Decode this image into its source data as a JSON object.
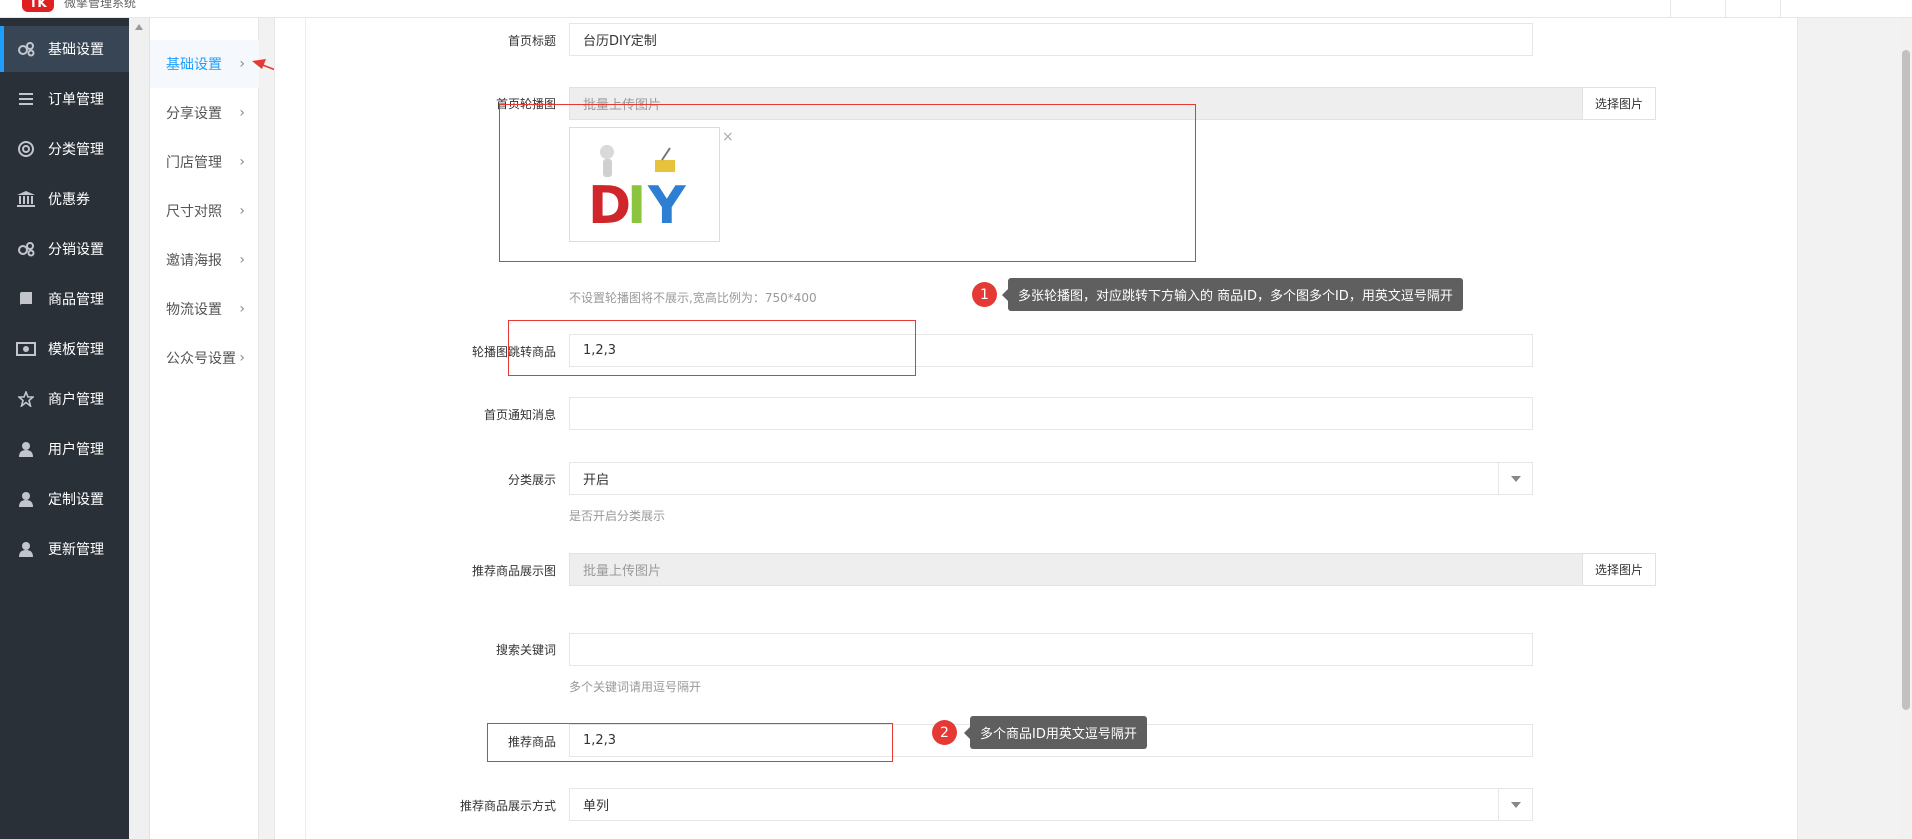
{
  "topbar": {
    "logo_text": "TK",
    "brand": "微擎管理系统"
  },
  "sidebar": {
    "items": [
      {
        "label": "基础设置",
        "icon": "cogs-icon",
        "active": true
      },
      {
        "label": "订单管理",
        "icon": "list-icon"
      },
      {
        "label": "分类管理",
        "icon": "support-icon"
      },
      {
        "label": "优惠券",
        "icon": "bank-icon"
      },
      {
        "label": "分销设置",
        "icon": "cogs-icon"
      },
      {
        "label": "商品管理",
        "icon": "book-icon"
      },
      {
        "label": "模板管理",
        "icon": "money-icon"
      },
      {
        "label": "商户管理",
        "icon": "star-icon"
      },
      {
        "label": "用户管理",
        "icon": "user-icon"
      },
      {
        "label": "定制设置",
        "icon": "user-icon"
      },
      {
        "label": "更新管理",
        "icon": "user-icon"
      }
    ]
  },
  "subnav": {
    "items": [
      {
        "label": "基础设置",
        "active": true
      },
      {
        "label": "分享设置"
      },
      {
        "label": "门店管理"
      },
      {
        "label": "尺寸对照"
      },
      {
        "label": "邀请海报"
      },
      {
        "label": "物流设置"
      },
      {
        "label": "公众号设置"
      }
    ]
  },
  "form": {
    "home_title": {
      "label": "首页标题",
      "value": "台历DIY定制"
    },
    "carousel": {
      "label": "首页轮播图",
      "placeholder": "批量上传图片",
      "button": "选择图片",
      "hint": "不设置轮播图将不展示,宽高比例为：750*400",
      "remove": "×"
    },
    "carousel_goods": {
      "label": "轮播图跳转商品",
      "value": "1,2,3"
    },
    "notice": {
      "label": "首页通知消息",
      "value": ""
    },
    "category_display": {
      "label": "分类展示",
      "value": "开启",
      "hint": "是否开启分类展示"
    },
    "recommend_image": {
      "label": "推荐商品展示图",
      "placeholder": "批量上传图片",
      "button": "选择图片"
    },
    "keywords": {
      "label": "搜索关键词",
      "value": "",
      "hint": "多个关键词请用逗号隔开"
    },
    "recommend_goods": {
      "label": "推荐商品",
      "value": "1,2,3"
    },
    "recommend_mode": {
      "label": "推荐商品展示方式",
      "value": "单列"
    }
  },
  "annotations": {
    "tip1": {
      "number": "1",
      "text": "多张轮播图，对应跳转下方输入的 商品ID，多个图多个ID，用英文逗号隔开"
    },
    "tip2": {
      "number": "2",
      "text": "多个商品ID用英文逗号隔开"
    }
  },
  "colors": {
    "sidebar_bg": "#293038",
    "accent": "#1e9fff",
    "annotation_red": "#e53935",
    "tooltip_bg": "#5f5f5f"
  }
}
